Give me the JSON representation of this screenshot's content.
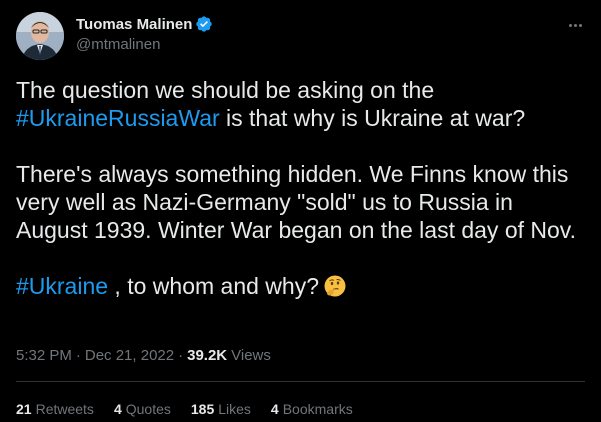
{
  "author": {
    "display_name": "Tuomas Malinen",
    "handle": "@mtmalinen",
    "verified": true
  },
  "tweet": {
    "line1_pre": "The question we should be asking on the",
    "hashtag1": "#UkraineRussiaWar",
    "line1_post": " is that why is Ukraine at war?",
    "paragraph2": "There's always something hidden. We Finns know this very well as Nazi-Germany \"sold\" us to Russia in August 1939. Winter War began on the last day of Nov.",
    "hashtag2": "#Ukraine",
    "line3_post": " , to whom and why?",
    "emoji": "thinking-face"
  },
  "meta": {
    "time": "5:32 PM",
    "date": "Dec 21, 2022",
    "views_count": "39.2K",
    "views_label": "Views"
  },
  "stats": {
    "retweets_count": "21",
    "retweets_label": "Retweets",
    "quotes_count": "4",
    "quotes_label": "Quotes",
    "likes_count": "185",
    "likes_label": "Likes",
    "bookmarks_count": "4",
    "bookmarks_label": "Bookmarks"
  },
  "colors": {
    "background": "#000000",
    "text": "#e7e9ea",
    "secondary": "#71767b",
    "accent": "#1d9bf0",
    "divider": "#2f3336"
  }
}
